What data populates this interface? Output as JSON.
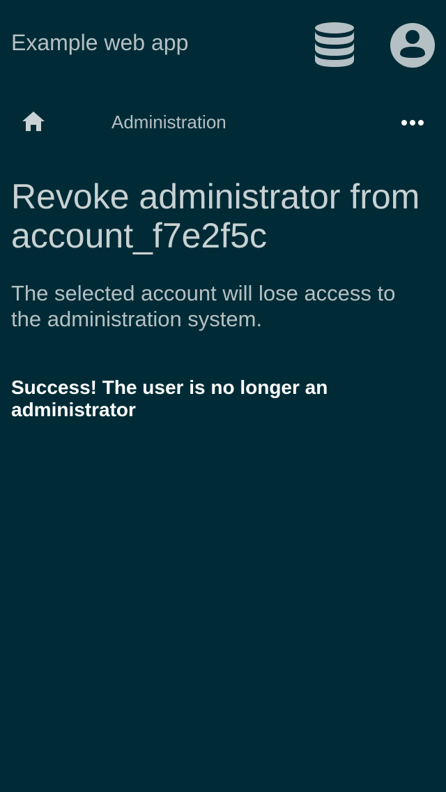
{
  "header": {
    "app_title": "Example web app",
    "database_icon": "database-icon",
    "account_icon": "account-circle-icon"
  },
  "breadcrumb": {
    "home_icon": "home-icon",
    "current": "Administration",
    "more_icon": "more-horizontal-icon"
  },
  "main": {
    "title": "Revoke administrator from account_f7e2f5c",
    "description": "The selected account will lose access to the administration system.",
    "success_message": "Success! The user is no longer an administrator"
  },
  "colors": {
    "background": "#002b36",
    "text": "#b4c0c4",
    "success_text": "#ffffff"
  }
}
